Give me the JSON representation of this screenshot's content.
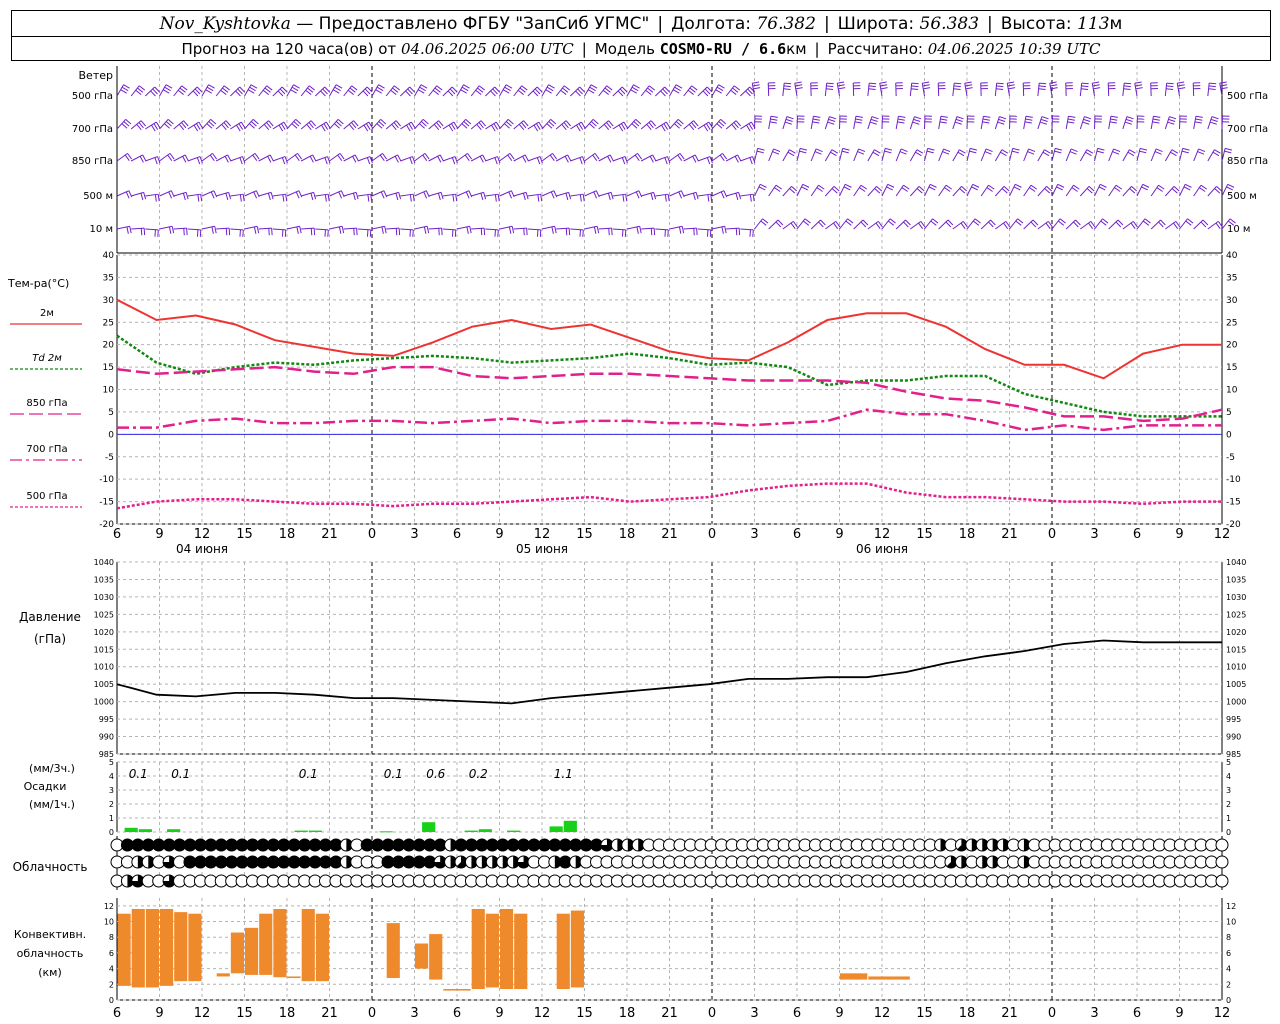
{
  "header": {
    "station": "Nov_Kyshtovka",
    "provider": "— Предоставлено ФГБУ \"ЗапСиб УГМС\"",
    "lon_label": "Долгота:",
    "lon": "76.382",
    "lat_label": "Широта:",
    "lat": "56.383",
    "alt_label": "Высота:",
    "alt": "113",
    "alt_unit": "м",
    "forecast_prefix": "Прогноз на 120 часа(ов) от",
    "forecast_start": "04.06.2025 06:00 UTC",
    "model_label": "Модель",
    "model": "COSMO-RU / 6.6",
    "model_unit": "км",
    "computed_label": "Рассчитано:",
    "computed": "04.06.2025 10:39 UTC"
  },
  "chart_data": [
    {
      "type": "wind_barbs",
      "title": "Ветер",
      "levels": [
        "500 гПа",
        "700 гПа",
        "850 гПа",
        "500 м",
        "10 м"
      ]
    },
    {
      "type": "line",
      "title": "Тем-ра(°C)",
      "ylim": [
        -20,
        40
      ],
      "yticks": [
        -20,
        -15,
        -10,
        -5,
        0,
        5,
        10,
        15,
        20,
        25,
        30,
        35,
        40
      ],
      "x_hours": [
        0,
        3,
        6,
        9,
        12,
        15,
        18,
        21,
        24,
        27,
        30,
        33,
        36,
        39,
        42,
        45,
        48,
        51,
        54,
        57,
        60,
        63,
        66,
        69,
        72,
        75,
        78
      ],
      "series": [
        {
          "name": "2м",
          "color": "#ee3333",
          "style": "solid",
          "values": [
            30,
            25.5,
            26.5,
            24.5,
            21,
            19.5,
            18,
            17.5,
            20.5,
            24,
            25.5,
            23.5,
            24.5,
            21.5,
            18.5,
            17,
            16.5,
            20.5,
            25.5,
            27,
            27,
            24,
            19,
            15.5,
            15.5,
            12.5,
            18,
            20,
            20
          ]
        },
        {
          "name": "Td 2м",
          "color": "#118811",
          "style": "dotted",
          "values": [
            22,
            16,
            13.5,
            15,
            16,
            15.5,
            16.5,
            17,
            17.5,
            17,
            16,
            16.5,
            17,
            18,
            17,
            15.5,
            16,
            15,
            11,
            12,
            12,
            13,
            13,
            9,
            7,
            5,
            4,
            4,
            4
          ]
        },
        {
          "name": "850 гПа",
          "color": "#e0208c",
          "style": "long-dash",
          "values": [
            14.5,
            13.5,
            14,
            14.5,
            15,
            14,
            13.5,
            15,
            15,
            13,
            12.5,
            13,
            13.5,
            13.5,
            13,
            12.5,
            12,
            12,
            12,
            11.5,
            9.5,
            8,
            7.5,
            6,
            4,
            4,
            3,
            3.5,
            5.5
          ]
        },
        {
          "name": "700 гПа",
          "color": "#e0208c",
          "style": "dash-dot",
          "values": [
            1.5,
            1.5,
            3,
            3.5,
            2.5,
            2.5,
            3,
            3,
            2.5,
            3,
            3.5,
            2.5,
            3,
            3,
            2.5,
            2.5,
            2,
            2.5,
            3,
            5.5,
            4.5,
            4.5,
            3,
            1,
            2,
            1,
            2,
            2,
            2
          ]
        },
        {
          "name": "500 гПа",
          "color": "#e0208c",
          "style": "dotted",
          "values": [
            -16.5,
            -15,
            -14.5,
            -14.5,
            -15,
            -15.5,
            -15.5,
            -16,
            -15.5,
            -15.5,
            -15,
            -14.5,
            -14,
            -15,
            -14.5,
            -14,
            -12.5,
            -11.5,
            -11,
            -11,
            -13,
            -14,
            -14,
            -14.5,
            -15,
            -15,
            -15.5,
            -15,
            -15
          ]
        }
      ]
    },
    {
      "type": "line",
      "title": "Давление (гПа)",
      "ylim": [
        985,
        1040
      ],
      "yticks": [
        985,
        990,
        995,
        1000,
        1005,
        1010,
        1015,
        1020,
        1025,
        1030,
        1035,
        1040
      ],
      "series": [
        {
          "name": "",
          "color": "#000000",
          "values": [
            1005,
            1002,
            1001.5,
            1002.5,
            1002.5,
            1002,
            1001,
            1001,
            1000.5,
            1000,
            999.5,
            1001,
            1002,
            1003,
            1004,
            1005,
            1006.5,
            1006.5,
            1007,
            1007,
            1008.5,
            1011,
            1013,
            1014.5,
            1016.5,
            1017.5,
            1017,
            1017,
            1017
          ]
        }
      ]
    },
    {
      "type": "bar",
      "title": "Осадки",
      "ylabel_3h": "(мм/3ч.)",
      "ylabel_1h": "(мм/1ч.)",
      "ylim": [
        0,
        5
      ],
      "yticks": [
        0,
        1,
        2,
        3,
        4,
        5
      ],
      "totals_3h": [
        {
          "hour": 1.5,
          "label": "0.1"
        },
        {
          "hour": 4.5,
          "label": "0.1"
        },
        {
          "hour": 13.5,
          "label": "0.1"
        },
        {
          "hour": 19.5,
          "label": "0.1"
        },
        {
          "hour": 22.5,
          "label": "0.6"
        },
        {
          "hour": 25.5,
          "label": "0.2"
        },
        {
          "hour": 31.5,
          "label": "1.1"
        }
      ],
      "hourly": [
        {
          "hour": 1,
          "value": 0.3
        },
        {
          "hour": 2,
          "value": 0.2
        },
        {
          "hour": 4,
          "value": 0.2
        },
        {
          "hour": 13,
          "value": 0.1
        },
        {
          "hour": 14,
          "value": 0.1
        },
        {
          "hour": 19,
          "value": 0.05
        },
        {
          "hour": 22,
          "value": 0.7
        },
        {
          "hour": 25,
          "value": 0.1
        },
        {
          "hour": 26,
          "value": 0.2
        },
        {
          "hour": 28,
          "value": 0.1
        },
        {
          "hour": 31,
          "value": 0.4
        },
        {
          "hour": 32,
          "value": 0.8
        }
      ]
    },
    {
      "type": "symbols",
      "title": "Облачность",
      "rows": [
        "high",
        "middle",
        "low"
      ],
      "cover_eighths": [
        [
          0,
          8,
          8,
          8,
          8,
          8,
          8,
          8,
          8,
          8,
          8,
          8,
          8,
          8,
          8,
          8,
          8,
          8,
          8,
          8,
          8,
          8,
          4,
          0,
          8,
          8,
          8,
          8,
          8,
          8,
          8,
          8,
          4,
          8,
          8,
          8,
          8,
          8,
          8,
          8,
          8,
          8,
          8,
          8,
          8,
          8,
          8,
          6,
          4,
          4,
          4,
          0,
          0,
          0,
          0,
          0,
          0,
          0,
          0,
          0,
          0,
          0,
          0,
          0,
          0,
          0,
          0,
          0,
          0,
          0,
          0,
          0,
          0,
          0,
          0,
          0,
          0,
          0,
          0,
          4,
          0,
          5,
          4,
          4,
          4,
          4,
          0,
          4,
          0,
          0,
          0,
          0,
          0,
          0,
          0,
          0,
          0,
          0,
          0,
          0,
          0,
          0,
          0,
          0,
          0,
          0,
          0
        ],
        [
          0,
          0,
          4,
          4,
          0,
          6,
          0,
          8,
          8,
          8,
          8,
          8,
          8,
          8,
          8,
          8,
          8,
          8,
          8,
          8,
          8,
          8,
          4,
          0,
          0,
          0,
          8,
          8,
          8,
          8,
          8,
          6,
          4,
          5,
          4,
          4,
          4,
          4,
          4,
          6,
          0,
          0,
          4,
          8,
          4,
          0,
          0,
          0,
          0,
          0,
          0,
          0,
          0,
          0,
          0,
          0,
          0,
          0,
          0,
          0,
          0,
          0,
          0,
          0,
          0,
          0,
          0,
          0,
          0,
          0,
          0,
          0,
          0,
          0,
          0,
          0,
          0,
          0,
          0,
          0,
          5,
          4,
          0,
          4,
          4,
          0,
          0,
          4,
          0,
          0,
          0,
          0,
          0,
          0,
          0,
          0,
          0,
          0,
          0,
          0,
          0,
          0,
          0,
          0,
          0,
          0,
          0
        ],
        [
          0,
          4,
          6,
          0,
          0,
          6,
          0,
          0,
          0,
          0,
          0,
          0,
          0,
          0,
          0,
          0,
          0,
          0,
          0,
          0,
          0,
          0,
          0,
          0,
          0,
          0,
          0,
          0,
          0,
          0,
          0,
          0,
          0,
          0,
          0,
          0,
          0,
          0,
          0,
          0,
          0,
          0,
          0,
          0,
          0,
          0,
          0,
          0,
          0,
          0,
          0,
          0,
          0,
          0,
          0,
          0,
          0,
          0,
          0,
          0,
          0,
          0,
          0,
          0,
          0,
          0,
          0,
          0,
          0,
          0,
          0,
          0,
          0,
          0,
          0,
          0,
          0,
          0,
          0,
          0,
          0,
          0,
          0,
          0,
          0,
          0,
          0,
          0,
          0,
          0,
          0,
          0,
          0,
          0,
          0,
          0,
          0,
          0,
          0,
          0,
          0,
          0,
          0,
          0,
          0,
          0,
          0
        ]
      ]
    },
    {
      "type": "range_bar",
      "title": "Конвективн. облачность (км)",
      "ylim": [
        0,
        13
      ],
      "yticks": [
        0,
        2,
        4,
        6,
        8,
        10,
        12
      ],
      "bars": [
        {
          "h0": 0,
          "h1": 1,
          "base": 1.8,
          "top": 11
        },
        {
          "h0": 1,
          "h1": 2,
          "base": 1.6,
          "top": 11.6
        },
        {
          "h0": 2,
          "h1": 3,
          "base": 1.6,
          "top": 11.6
        },
        {
          "h0": 3,
          "h1": 4,
          "base": 1.8,
          "top": 11.6
        },
        {
          "h0": 4,
          "h1": 5,
          "base": 2.4,
          "top": 11.2
        },
        {
          "h0": 5,
          "h1": 6,
          "base": 2.4,
          "top": 11
        },
        {
          "h0": 7,
          "h1": 8,
          "base": 3,
          "top": 3.4
        },
        {
          "h0": 8,
          "h1": 9,
          "base": 3.4,
          "top": 8.6
        },
        {
          "h0": 9,
          "h1": 10,
          "base": 3.2,
          "top": 9.2
        },
        {
          "h0": 10,
          "h1": 11,
          "base": 3.2,
          "top": 11
        },
        {
          "h0": 11,
          "h1": 12,
          "base": 2.9,
          "top": 11.6
        },
        {
          "h0": 12,
          "h1": 13,
          "base": 2.8,
          "top": 3
        },
        {
          "h0": 13,
          "h1": 14,
          "base": 2.4,
          "top": 11.6
        },
        {
          "h0": 14,
          "h1": 15,
          "base": 2.4,
          "top": 11
        },
        {
          "h0": 19,
          "h1": 20,
          "base": 2.8,
          "top": 9.8
        },
        {
          "h0": 21,
          "h1": 22,
          "base": 4,
          "top": 7.2
        },
        {
          "h0": 22,
          "h1": 23,
          "base": 2.6,
          "top": 8.4
        },
        {
          "h0": 23,
          "h1": 25,
          "base": 1.2,
          "top": 1.4
        },
        {
          "h0": 25,
          "h1": 26,
          "base": 1.4,
          "top": 11.6
        },
        {
          "h0": 26,
          "h1": 27,
          "base": 1.6,
          "top": 11
        },
        {
          "h0": 27,
          "h1": 28,
          "base": 1.4,
          "top": 11.6
        },
        {
          "h0": 28,
          "h1": 29,
          "base": 1.4,
          "top": 11
        },
        {
          "h0": 31,
          "h1": 32,
          "base": 1.4,
          "top": 11
        },
        {
          "h0": 32,
          "h1": 33,
          "base": 1.6,
          "top": 11.4
        },
        {
          "h0": 51,
          "h1": 53,
          "base": 2.6,
          "top": 3.4
        },
        {
          "h0": 53,
          "h1": 56,
          "base": 2.6,
          "top": 3
        }
      ]
    }
  ],
  "axis": {
    "hour_ticks": [
      "6",
      "9",
      "12",
      "15",
      "18",
      "21",
      "0",
      "3",
      "6",
      "9",
      "12",
      "15",
      "18",
      "21",
      "0",
      "3",
      "6",
      "9",
      "12",
      "15",
      "18",
      "21",
      "0",
      "3",
      "6",
      "9",
      "12"
    ],
    "days": [
      "04 июня",
      "05 июня",
      "06 июня"
    ]
  },
  "colors": {
    "wind": "#7020c8",
    "grid": "#b4b4b4",
    "zero_line": "#2a2ae0",
    "precip": "#18d018",
    "conv": "#ef8a2c"
  }
}
